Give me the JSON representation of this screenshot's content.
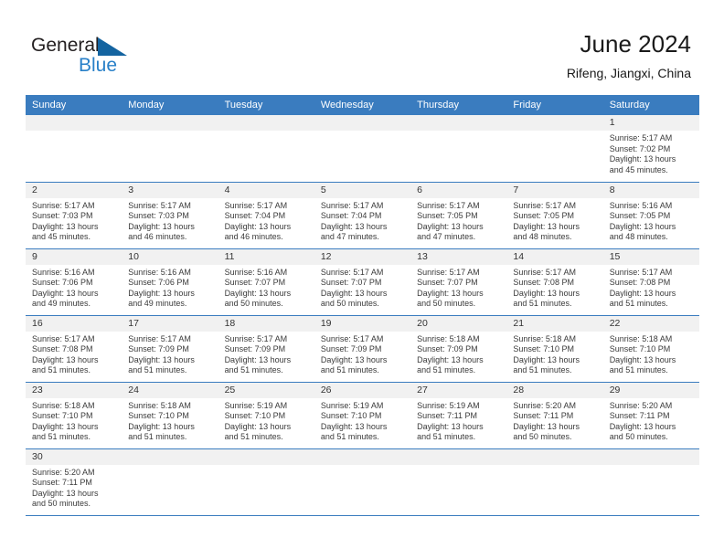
{
  "brand": {
    "name_top": "General",
    "name_bottom": "Blue",
    "flag_icon": "blue-triangle-flag-icon",
    "top_color": "#231f20",
    "bottom_color": "#2980c8"
  },
  "header": {
    "title": "June 2024",
    "subtitle": "Rifeng, Jiangxi, China"
  },
  "theme": {
    "header_bg": "#3a7cbf",
    "header_text": "#ffffff",
    "daynum_bg": "#f1f1f1",
    "row_rule": "#3a7cbf",
    "body_text": "#3a3a3a"
  },
  "weekday_headers": [
    "Sunday",
    "Monday",
    "Tuesday",
    "Wednesday",
    "Thursday",
    "Friday",
    "Saturday"
  ],
  "weeks": [
    [
      {
        "day": "",
        "lines": []
      },
      {
        "day": "",
        "lines": []
      },
      {
        "day": "",
        "lines": []
      },
      {
        "day": "",
        "lines": []
      },
      {
        "day": "",
        "lines": []
      },
      {
        "day": "",
        "lines": []
      },
      {
        "day": "1",
        "lines": [
          "Sunrise: 5:17 AM",
          "Sunset: 7:02 PM",
          "Daylight: 13 hours",
          "and 45 minutes."
        ]
      }
    ],
    [
      {
        "day": "2",
        "lines": [
          "Sunrise: 5:17 AM",
          "Sunset: 7:03 PM",
          "Daylight: 13 hours",
          "and 45 minutes."
        ]
      },
      {
        "day": "3",
        "lines": [
          "Sunrise: 5:17 AM",
          "Sunset: 7:03 PM",
          "Daylight: 13 hours",
          "and 46 minutes."
        ]
      },
      {
        "day": "4",
        "lines": [
          "Sunrise: 5:17 AM",
          "Sunset: 7:04 PM",
          "Daylight: 13 hours",
          "and 46 minutes."
        ]
      },
      {
        "day": "5",
        "lines": [
          "Sunrise: 5:17 AM",
          "Sunset: 7:04 PM",
          "Daylight: 13 hours",
          "and 47 minutes."
        ]
      },
      {
        "day": "6",
        "lines": [
          "Sunrise: 5:17 AM",
          "Sunset: 7:05 PM",
          "Daylight: 13 hours",
          "and 47 minutes."
        ]
      },
      {
        "day": "7",
        "lines": [
          "Sunrise: 5:17 AM",
          "Sunset: 7:05 PM",
          "Daylight: 13 hours",
          "and 48 minutes."
        ]
      },
      {
        "day": "8",
        "lines": [
          "Sunrise: 5:16 AM",
          "Sunset: 7:05 PM",
          "Daylight: 13 hours",
          "and 48 minutes."
        ]
      }
    ],
    [
      {
        "day": "9",
        "lines": [
          "Sunrise: 5:16 AM",
          "Sunset: 7:06 PM",
          "Daylight: 13 hours",
          "and 49 minutes."
        ]
      },
      {
        "day": "10",
        "lines": [
          "Sunrise: 5:16 AM",
          "Sunset: 7:06 PM",
          "Daylight: 13 hours",
          "and 49 minutes."
        ]
      },
      {
        "day": "11",
        "lines": [
          "Sunrise: 5:16 AM",
          "Sunset: 7:07 PM",
          "Daylight: 13 hours",
          "and 50 minutes."
        ]
      },
      {
        "day": "12",
        "lines": [
          "Sunrise: 5:17 AM",
          "Sunset: 7:07 PM",
          "Daylight: 13 hours",
          "and 50 minutes."
        ]
      },
      {
        "day": "13",
        "lines": [
          "Sunrise: 5:17 AM",
          "Sunset: 7:07 PM",
          "Daylight: 13 hours",
          "and 50 minutes."
        ]
      },
      {
        "day": "14",
        "lines": [
          "Sunrise: 5:17 AM",
          "Sunset: 7:08 PM",
          "Daylight: 13 hours",
          "and 51 minutes."
        ]
      },
      {
        "day": "15",
        "lines": [
          "Sunrise: 5:17 AM",
          "Sunset: 7:08 PM",
          "Daylight: 13 hours",
          "and 51 minutes."
        ]
      }
    ],
    [
      {
        "day": "16",
        "lines": [
          "Sunrise: 5:17 AM",
          "Sunset: 7:08 PM",
          "Daylight: 13 hours",
          "and 51 minutes."
        ]
      },
      {
        "day": "17",
        "lines": [
          "Sunrise: 5:17 AM",
          "Sunset: 7:09 PM",
          "Daylight: 13 hours",
          "and 51 minutes."
        ]
      },
      {
        "day": "18",
        "lines": [
          "Sunrise: 5:17 AM",
          "Sunset: 7:09 PM",
          "Daylight: 13 hours",
          "and 51 minutes."
        ]
      },
      {
        "day": "19",
        "lines": [
          "Sunrise: 5:17 AM",
          "Sunset: 7:09 PM",
          "Daylight: 13 hours",
          "and 51 minutes."
        ]
      },
      {
        "day": "20",
        "lines": [
          "Sunrise: 5:18 AM",
          "Sunset: 7:09 PM",
          "Daylight: 13 hours",
          "and 51 minutes."
        ]
      },
      {
        "day": "21",
        "lines": [
          "Sunrise: 5:18 AM",
          "Sunset: 7:10 PM",
          "Daylight: 13 hours",
          "and 51 minutes."
        ]
      },
      {
        "day": "22",
        "lines": [
          "Sunrise: 5:18 AM",
          "Sunset: 7:10 PM",
          "Daylight: 13 hours",
          "and 51 minutes."
        ]
      }
    ],
    [
      {
        "day": "23",
        "lines": [
          "Sunrise: 5:18 AM",
          "Sunset: 7:10 PM",
          "Daylight: 13 hours",
          "and 51 minutes."
        ]
      },
      {
        "day": "24",
        "lines": [
          "Sunrise: 5:18 AM",
          "Sunset: 7:10 PM",
          "Daylight: 13 hours",
          "and 51 minutes."
        ]
      },
      {
        "day": "25",
        "lines": [
          "Sunrise: 5:19 AM",
          "Sunset: 7:10 PM",
          "Daylight: 13 hours",
          "and 51 minutes."
        ]
      },
      {
        "day": "26",
        "lines": [
          "Sunrise: 5:19 AM",
          "Sunset: 7:10 PM",
          "Daylight: 13 hours",
          "and 51 minutes."
        ]
      },
      {
        "day": "27",
        "lines": [
          "Sunrise: 5:19 AM",
          "Sunset: 7:11 PM",
          "Daylight: 13 hours",
          "and 51 minutes."
        ]
      },
      {
        "day": "28",
        "lines": [
          "Sunrise: 5:20 AM",
          "Sunset: 7:11 PM",
          "Daylight: 13 hours",
          "and 50 minutes."
        ]
      },
      {
        "day": "29",
        "lines": [
          "Sunrise: 5:20 AM",
          "Sunset: 7:11 PM",
          "Daylight: 13 hours",
          "and 50 minutes."
        ]
      }
    ],
    [
      {
        "day": "30",
        "lines": [
          "Sunrise: 5:20 AM",
          "Sunset: 7:11 PM",
          "Daylight: 13 hours",
          "and 50 minutes."
        ]
      },
      {
        "day": "",
        "lines": []
      },
      {
        "day": "",
        "lines": []
      },
      {
        "day": "",
        "lines": []
      },
      {
        "day": "",
        "lines": []
      },
      {
        "day": "",
        "lines": []
      },
      {
        "day": "",
        "lines": []
      }
    ]
  ]
}
